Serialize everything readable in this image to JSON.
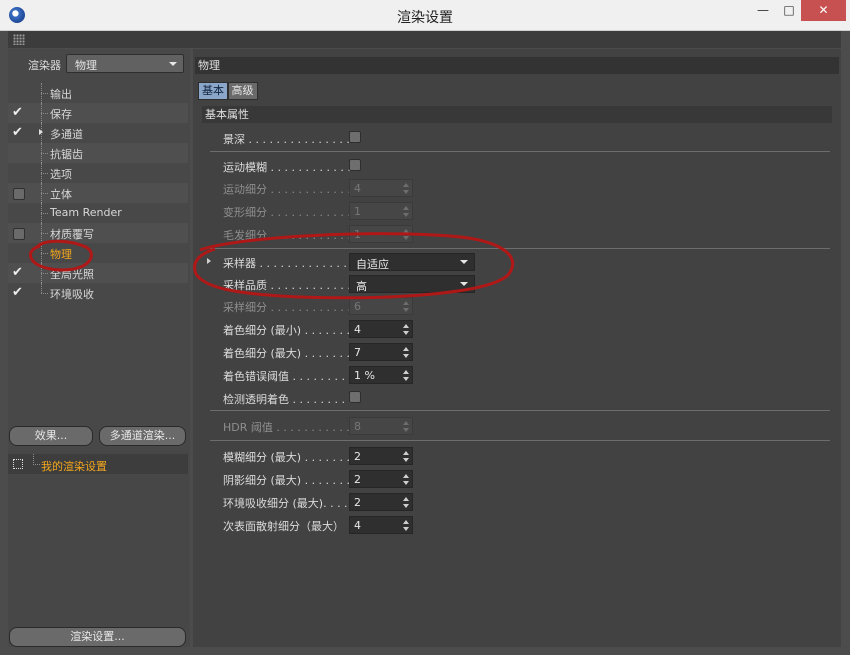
{
  "window": {
    "title": "渲染设置"
  },
  "sidebar": {
    "renderer_label": "渲染器",
    "renderer_value": "物理",
    "items": [
      {
        "label": "输出",
        "check": "none"
      },
      {
        "label": "保存",
        "check": "checked"
      },
      {
        "label": "多通道",
        "check": "checked",
        "expandable": true
      },
      {
        "label": "抗锯齿",
        "check": "none"
      },
      {
        "label": "选项",
        "check": "none"
      },
      {
        "label": "立体",
        "check": "unchecked"
      },
      {
        "label": "Team Render",
        "check": "none"
      },
      {
        "label": "材质覆写",
        "check": "unchecked"
      },
      {
        "label": "物理",
        "check": "none",
        "active": true
      },
      {
        "label": "全局光照",
        "check": "checked"
      },
      {
        "label": "环境吸收",
        "check": "checked"
      }
    ],
    "effects_button": "效果...",
    "multipass_button": "多通道渲染...",
    "preset_label": "我的渲染设置",
    "render_settings_button": "渲染设置..."
  },
  "main": {
    "section_title": "物理",
    "tabs": [
      {
        "label": "基本",
        "active": true
      },
      {
        "label": "高级",
        "active": false
      }
    ],
    "group_title": "基本属性",
    "fields": {
      "depth_of_field": {
        "label": "景深 . . . . . . . . . . . . . . . ."
      },
      "motion_blur": {
        "label": "运动模糊 . . . . . . . . . . . . ."
      },
      "motion_subdiv": {
        "label": "运动细分 . . . . . . . . . . . . .",
        "value": "4"
      },
      "deform_subdiv": {
        "label": "变形细分 . . . . . . . . . . . . .",
        "value": "1"
      },
      "hair_subdiv": {
        "label": "毛发细分 . . . . . . . . . . . . .",
        "value": "1"
      },
      "sampler": {
        "label": "采样器 . . . . . . . . . . . . . . .",
        "value": "自适应"
      },
      "sampling_quality": {
        "label": "采样品质 . . . . . . . . . . . . .",
        "value": "高"
      },
      "sampling_subdiv": {
        "label": "采样细分 . . . . . . . . . . . . .",
        "value": "6"
      },
      "shading_subdiv_min": {
        "label": "着色细分 (最小) . . . . . . .",
        "value": "4"
      },
      "shading_subdiv_max": {
        "label": "着色细分 (最大) . . . . . . .",
        "value": "7"
      },
      "shading_error_threshold": {
        "label": "着色错误阈值 . . . . . . . . .",
        "value": "1 %"
      },
      "detect_transparent": {
        "label": "检测透明着色 . . . . . . . . ."
      },
      "hdr_threshold": {
        "label": "HDR 阈值 . . . . . . . . . . . .",
        "value": "8"
      },
      "blur_subdiv_max": {
        "label": "模糊细分 (最大) . . . . . . .",
        "value": "2"
      },
      "shadow_subdiv_max": {
        "label": "阴影细分 (最大) . . . . . . .",
        "value": "2"
      },
      "ao_subdiv_max": {
        "label": "环境吸收细分 (最大). . . .",
        "value": "2"
      },
      "sss_subdiv_max": {
        "label": "次表面散射细分（最大）",
        "value": "4"
      }
    }
  },
  "colors": {
    "active_text": "#f4a71c",
    "annotation_red": "#b01818",
    "tab_active": "#8aa6c9",
    "close_button": "#c75050"
  }
}
